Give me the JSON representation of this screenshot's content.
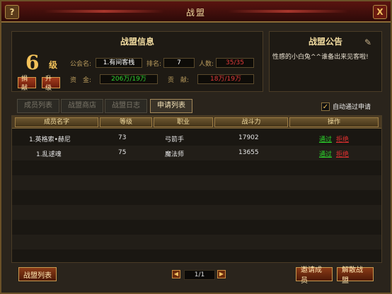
{
  "window": {
    "title": "战盟",
    "help": "?",
    "close": "X"
  },
  "info": {
    "title": "战盟信息",
    "level": "6",
    "level_unit": "级",
    "donate_label": "捐献",
    "upgrade_label": "升级",
    "guild_name_label": "公会名:",
    "guild_name": "1.有间客栈",
    "rank_label": "排名:",
    "rank": "7",
    "members_label": "人数:",
    "members": "35/35",
    "funds_label": "资　金:",
    "funds": "206万/19万",
    "contribution_label": "贡　献:",
    "contribution": "18万/19万"
  },
  "notice": {
    "title": "战盟公告",
    "text": "性感的小白兔^^谁备出来见客啦!"
  },
  "tabs": [
    {
      "label": "成员列表",
      "active": false
    },
    {
      "label": "战盟商店",
      "active": false
    },
    {
      "label": "战盟日志",
      "active": false
    },
    {
      "label": "申请列表",
      "active": true
    }
  ],
  "auto_accept": {
    "label": "自动通过申请",
    "checked": true
  },
  "table": {
    "headers": [
      "成员名字",
      "等级",
      "职业",
      "战斗力",
      "操作"
    ],
    "rows": [
      {
        "name": "1.英格索•赫尼",
        "level": "73",
        "job": "弓箭手",
        "power": "17902",
        "accept": "通过",
        "reject": "拒绝"
      },
      {
        "name": "1.乱逑魂",
        "level": "75",
        "job": "魔法师",
        "power": "13655",
        "accept": "通过",
        "reject": "拒绝"
      }
    ]
  },
  "footer": {
    "guild_list": "战盟列表",
    "page": "1/1",
    "invite": "邀请成员",
    "disband": "解散战盟"
  }
}
